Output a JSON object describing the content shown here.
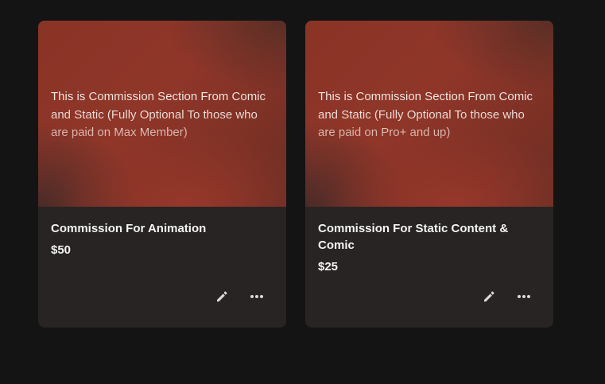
{
  "cards": [
    {
      "cover_text": "This is Commission Section From Comic and Static (Fully Optional To those who are paid on Max Member)",
      "title": "Commission For Animation",
      "price": "$50",
      "actions": {
        "edit_icon": "pencil-icon",
        "more_icon": "ellipsis-icon"
      }
    },
    {
      "cover_text": "This is Commission Section From Comic and Static (Fully Optional To those who are paid on Pro+ and up)",
      "title": "Commission For Static Content & Comic",
      "price": "$25",
      "actions": {
        "edit_icon": "pencil-icon",
        "more_icon": "ellipsis-icon"
      }
    }
  ],
  "colors": {
    "page_background": "#141414",
    "card_background": "#282423",
    "cover_accent": "#8f3629",
    "text_primary": "#f4f4f4"
  }
}
